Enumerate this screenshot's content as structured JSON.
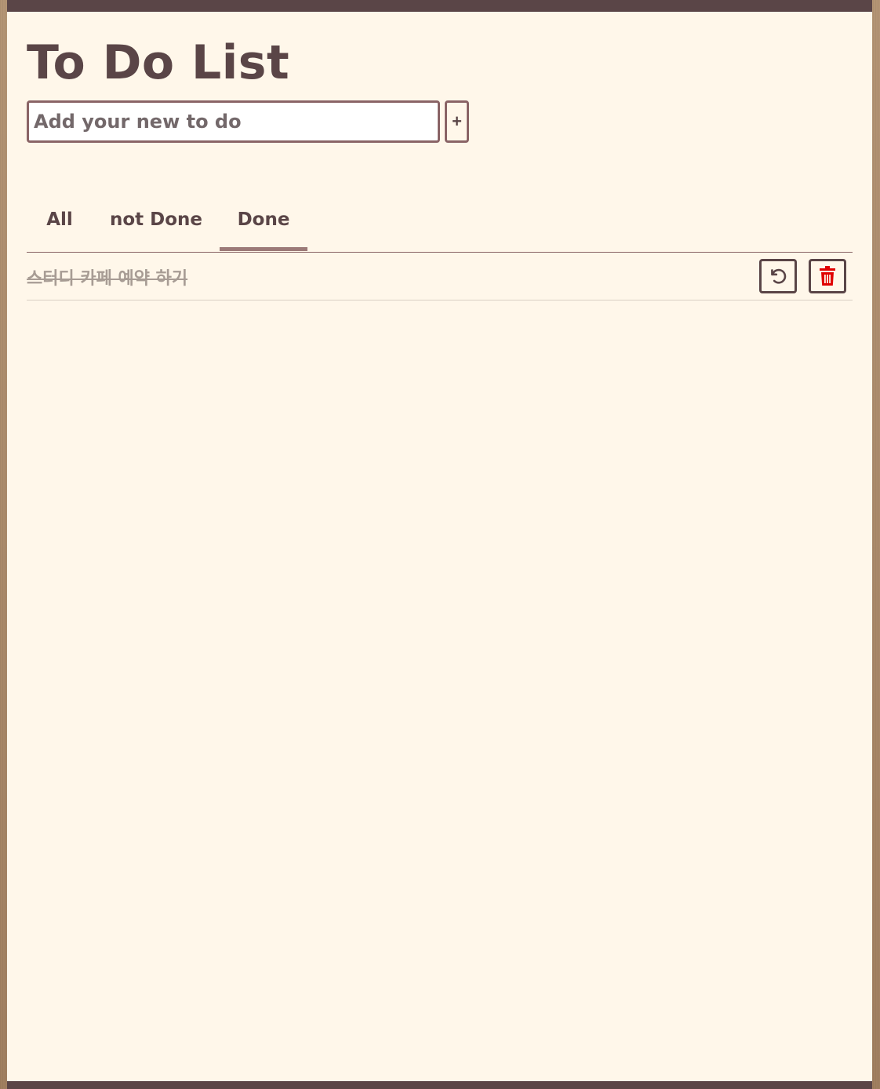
{
  "app": {
    "title": "To Do List"
  },
  "add_task": {
    "placeholder": "Add your new to do",
    "value": "",
    "button_label": "+"
  },
  "tabs": [
    {
      "label": "All",
      "active": false
    },
    {
      "label": "not Done",
      "active": false
    },
    {
      "label": "Done",
      "active": true
    }
  ],
  "tasks": [
    {
      "text": "스터디 카페 예약 하기",
      "done": true,
      "actions": [
        "undo-icon",
        "trash-icon"
      ]
    }
  ],
  "colors": {
    "primary": "#5a4547",
    "accent": "#9c7a78",
    "background": "#fff7ea",
    "delete": "#e00000",
    "done_text": "#a79c94"
  }
}
